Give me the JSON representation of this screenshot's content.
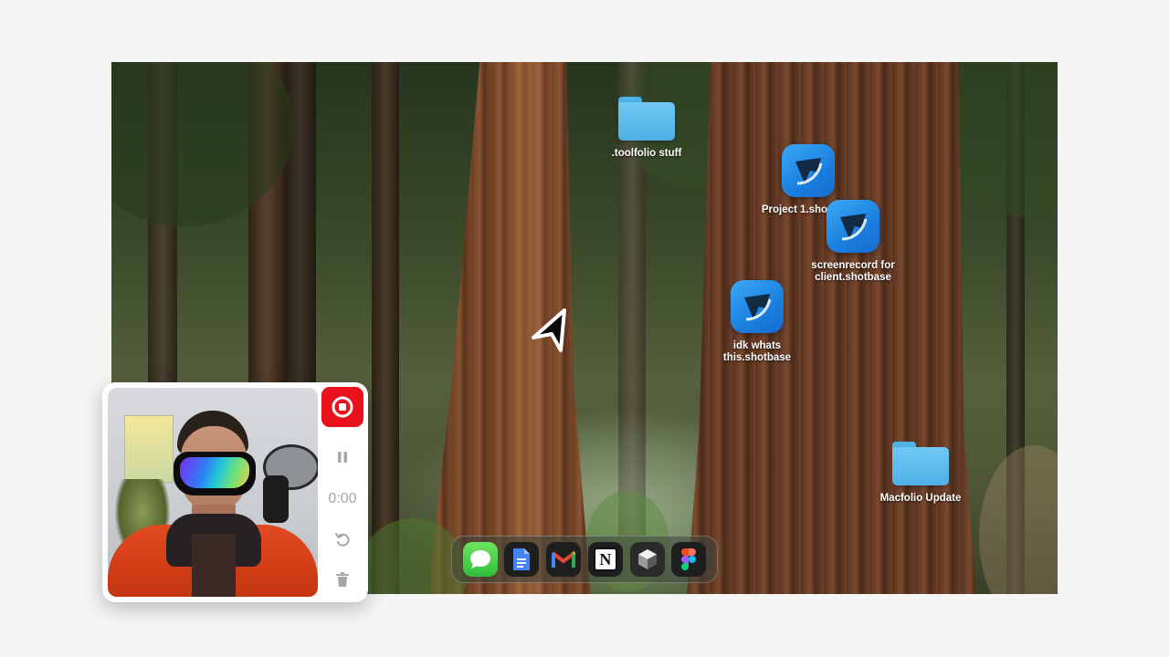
{
  "desktop": {
    "folders": [
      {
        "label": ".toolfolio stuff"
      },
      {
        "label": "Macfolio Update"
      }
    ],
    "files": [
      {
        "label": "Project 1.shotbase"
      },
      {
        "label": "screenrecord for\nclient.shotbase"
      },
      {
        "label": "idk whats\nthis.shotbase"
      }
    ]
  },
  "dock": {
    "apps": [
      {
        "name": "messages-icon"
      },
      {
        "name": "google-docs-icon"
      },
      {
        "name": "gmail-icon"
      },
      {
        "name": "notion-icon"
      },
      {
        "name": "cube-app-icon"
      },
      {
        "name": "figma-icon"
      }
    ],
    "notion_letter": "N",
    "gmail_letter": "M"
  },
  "recorder": {
    "timer": "0:00",
    "stop_color": "#e8111c"
  },
  "colors": {
    "folder": "#5fbdf0",
    "shotbase": "#2a95ee"
  }
}
